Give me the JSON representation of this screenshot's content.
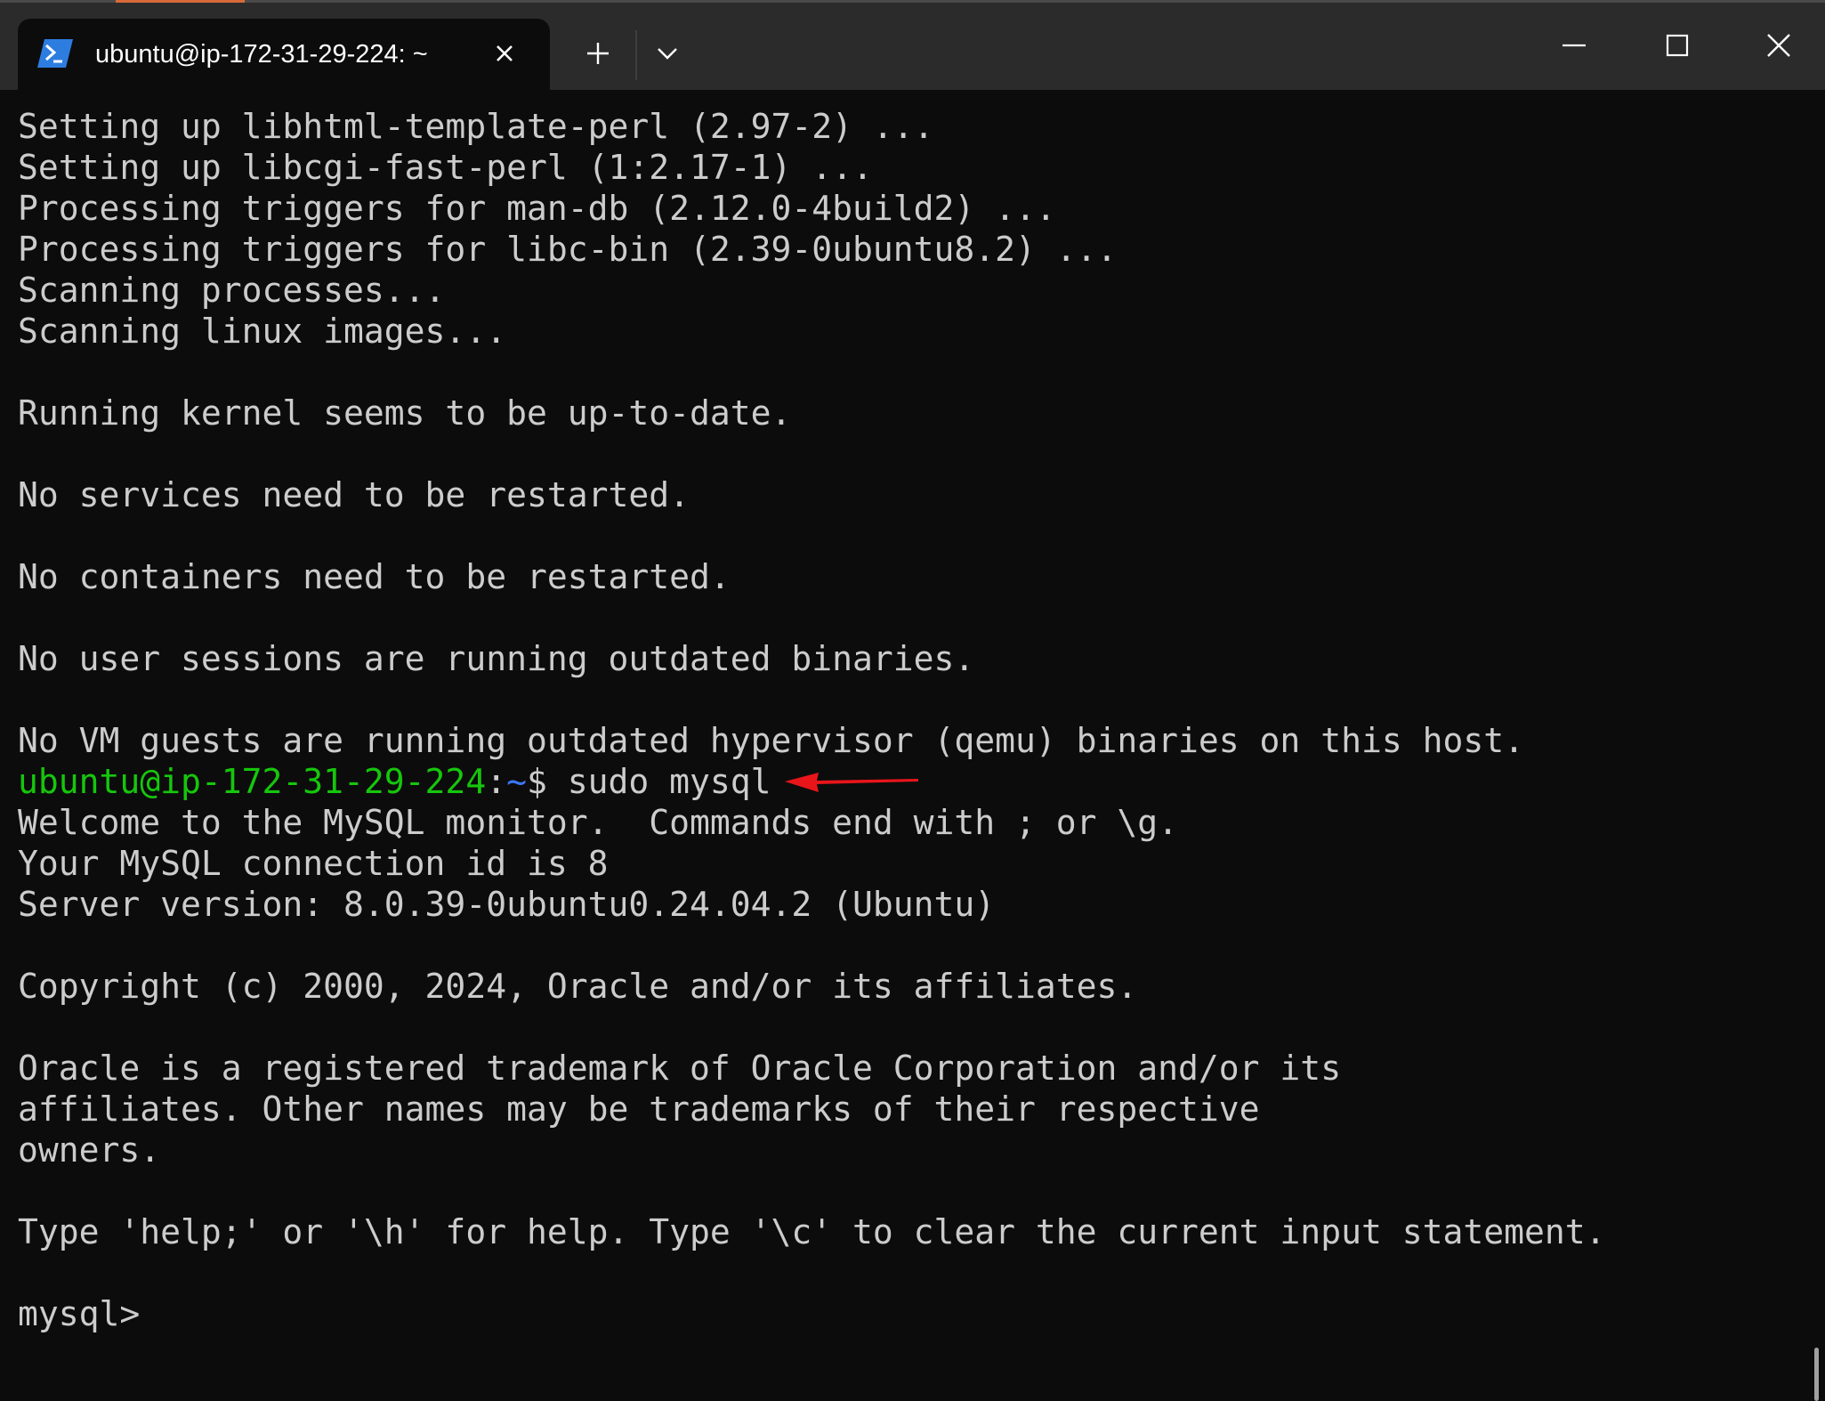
{
  "window": {
    "tab_title": "ubuntu@ip-172-31-29-224: ~",
    "tab_icon": "powershell-terminal-icon",
    "buttons": {
      "close_tab": "close-icon",
      "new_tab": "plus-icon",
      "dropdown": "chevron-down-icon",
      "minimize": "minimize-icon",
      "maximize": "maximize-icon",
      "close_window": "close-icon"
    }
  },
  "terminal": {
    "lines_before": [
      "Setting up libhtml-template-perl (2.97-2) ...",
      "Setting up libcgi-fast-perl (1:2.17-1) ...",
      "Processing triggers for man-db (2.12.0-4build2) ...",
      "Processing triggers for libc-bin (2.39-0ubuntu8.2) ...",
      "Scanning processes...",
      "Scanning linux images...",
      "",
      "Running kernel seems to be up-to-date.",
      "",
      "No services need to be restarted.",
      "",
      "No containers need to be restarted.",
      "",
      "No user sessions are running outdated binaries.",
      "",
      "No VM guests are running outdated hypervisor (qemu) binaries on this host."
    ],
    "prompt": {
      "user_host": "ubuntu@ip-172-31-29-224",
      "colon": ":",
      "path": "~",
      "dollar": "$ ",
      "command": "sudo mysql"
    },
    "lines_after": [
      "Welcome to the MySQL monitor.  Commands end with ; or \\g.",
      "Your MySQL connection id is 8",
      "Server version: 8.0.39-0ubuntu0.24.04.2 (Ubuntu)",
      "",
      "Copyright (c) 2000, 2024, Oracle and/or its affiliates.",
      "",
      "Oracle is a registered trademark of Oracle Corporation and/or its",
      "affiliates. Other names may be trademarks of their respective",
      "owners.",
      "",
      "Type 'help;' or '\\h' for help. Type '\\c' to clear the current input statement.",
      "",
      "mysql>"
    ]
  },
  "colors": {
    "background": "#0c0c0c",
    "titlebar": "#2b2b2b",
    "text": "#cccccc",
    "prompt_green": "#16c60c",
    "prompt_blue": "#3b78ff",
    "annotation_arrow": "#e8151b"
  }
}
